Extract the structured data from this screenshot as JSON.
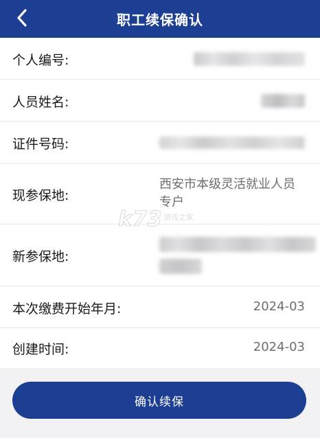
{
  "header": {
    "title": "职工续保确认",
    "back_icon": "chevron-left-icon",
    "background": "#1c3f94"
  },
  "fields": {
    "personal_id": {
      "label": "个人编号:"
    },
    "name": {
      "label": "人员姓名:"
    },
    "id_number": {
      "label": "证件号码:"
    },
    "current_location": {
      "label": "现参保地:",
      "value_line1": "西安市本级灵活就业人员",
      "value_line2": "专户"
    },
    "new_location": {
      "label": "新参保地:"
    },
    "start_month": {
      "label": "本次缴费开始年月:",
      "value": "2024-03"
    },
    "created_time": {
      "label": "创建时间:",
      "value": "2024-03"
    }
  },
  "actions": {
    "confirm_label": "确认续保",
    "accent": "#1c3f94"
  },
  "watermark": {
    "text": "k73",
    "subtext": "游戏之家"
  }
}
